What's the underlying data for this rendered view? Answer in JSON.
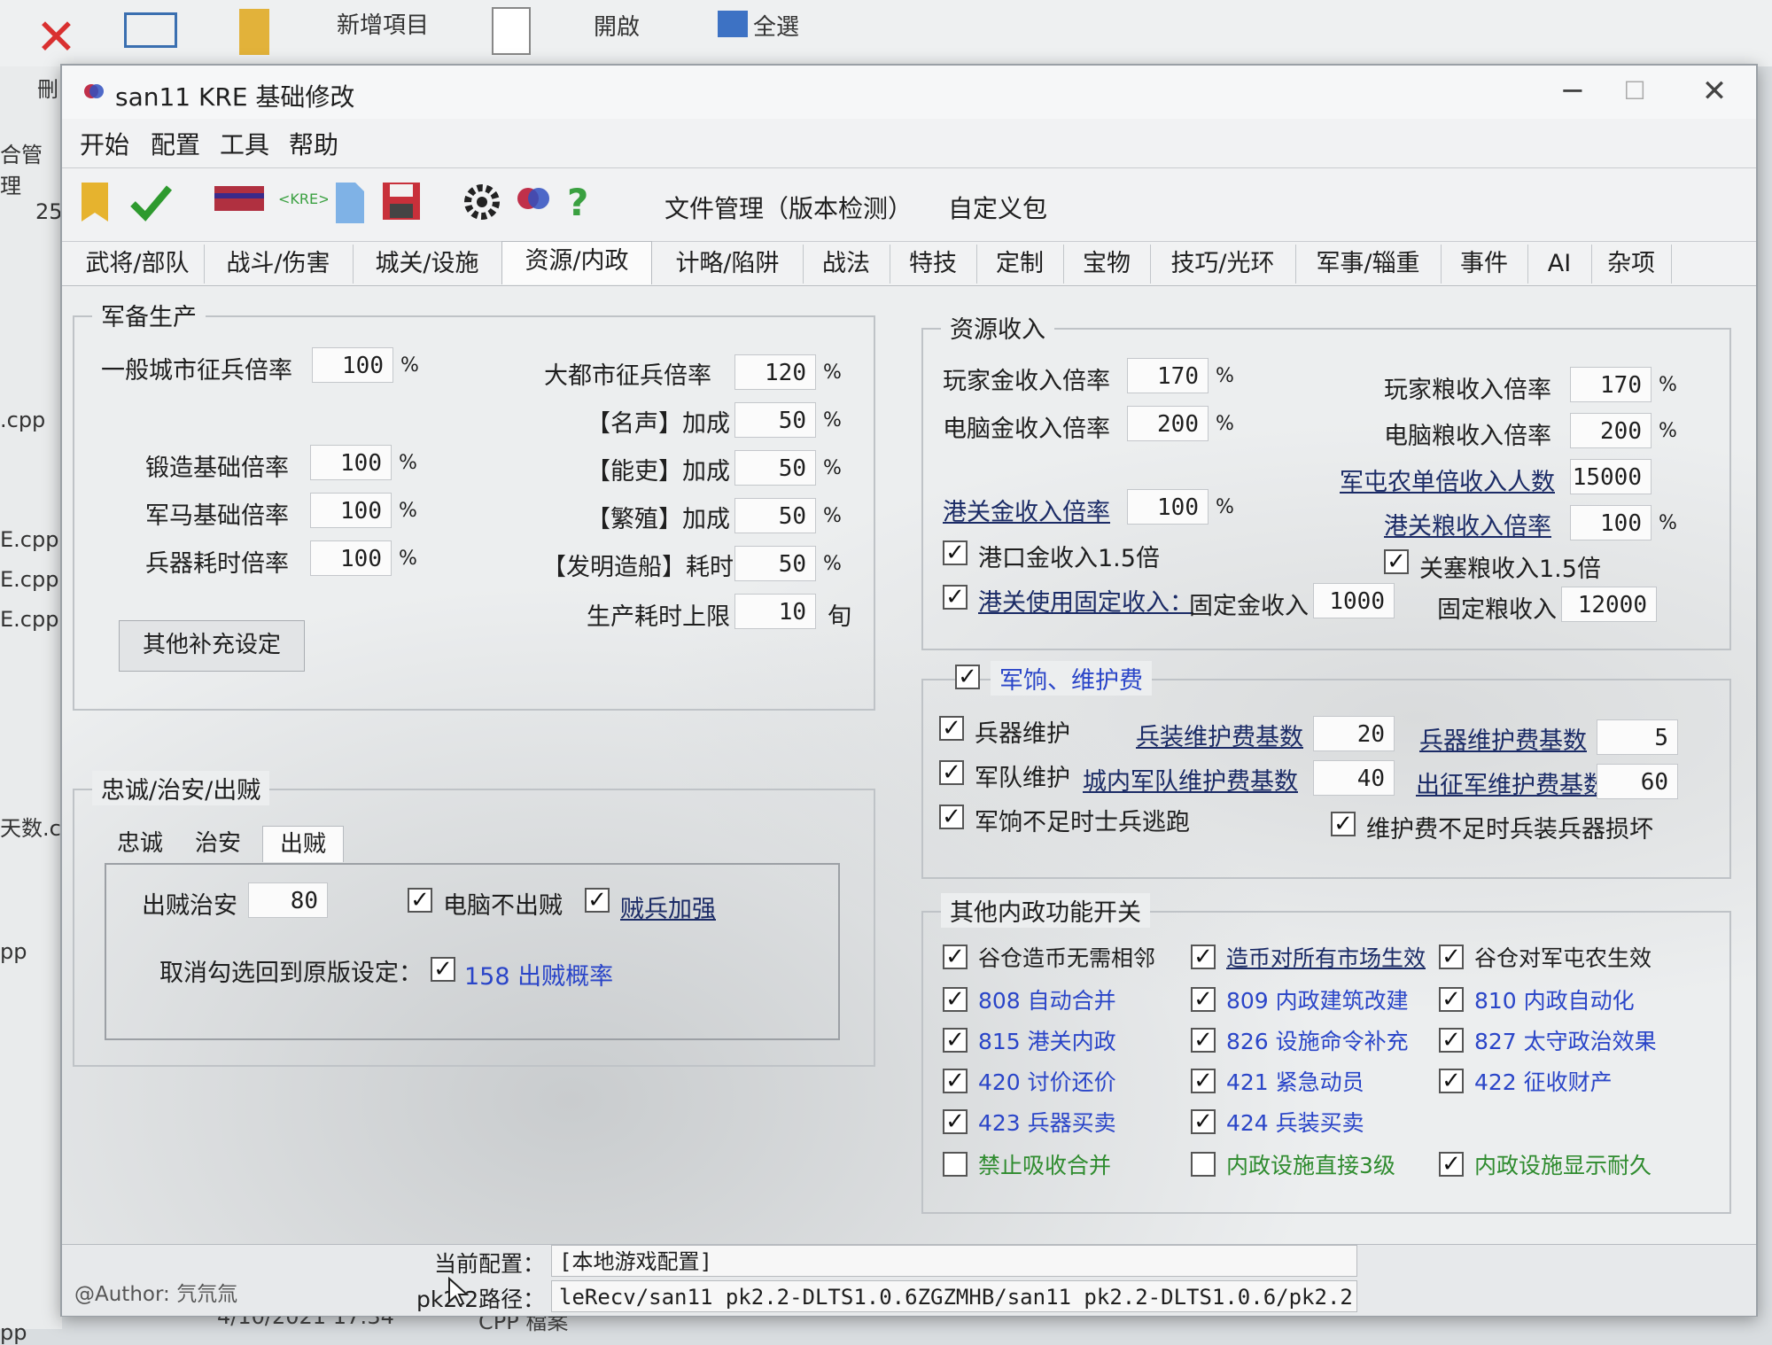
{
  "background": {
    "ribbon_items": [
      "新增項目",
      "開啟",
      "全選"
    ],
    "sidebar_texts": [
      "25",
      ".cpp",
      "E.cpp",
      "E.cpp",
      "E.cpp",
      "天数.c",
      "pp",
      "pp"
    ],
    "sidebar_top": "合管理",
    "left_label": "刪",
    "footer_date": "4/10/2021 17:34",
    "footer_type": "CPP 檔案"
  },
  "window": {
    "title": "san11 KRE 基础修改",
    "controls": {
      "minimize": "─",
      "maximize": "☐",
      "close": "✕"
    }
  },
  "menu": [
    "开始",
    "配置",
    "工具",
    "帮助"
  ],
  "toolbar": {
    "icons": [
      "bookmark-icon",
      "check-icon",
      "kre-logo-icon",
      "kre-arrows-icon",
      "document-icon",
      "save-icon",
      "gear-icon",
      "app-icon",
      "help-icon"
    ],
    "file_mgmt": "文件管理（版本检测）",
    "custom_pack": "自定义包"
  },
  "tabs": [
    "武将/部队",
    "战斗/伤害",
    "城关/设施",
    "资源/内政",
    "计略/陷阱",
    "战法",
    "特技",
    "定制",
    "宝物",
    "技巧/光环",
    "军事/辎重",
    "事件",
    "AI",
    "杂项"
  ],
  "active_tab": "资源/内政",
  "military_production": {
    "title": "军备生产",
    "general_city_rate": {
      "label": "一般城市征兵倍率",
      "value": "100",
      "unit": "%"
    },
    "metro_city_rate": {
      "label": "大都市征兵倍率",
      "value": "120",
      "unit": "%"
    },
    "fame_bonus": {
      "label": "【名声】加成",
      "value": "50",
      "unit": "%"
    },
    "official_bonus": {
      "label": "【能吏】加成",
      "value": "50",
      "unit": "%"
    },
    "breed_bonus": {
      "label": "【繁殖】加成",
      "value": "50",
      "unit": "%"
    },
    "forge_rate": {
      "label": "锻造基础倍率",
      "value": "100",
      "unit": "%"
    },
    "horse_rate": {
      "label": "军马基础倍率",
      "value": "100",
      "unit": "%"
    },
    "weapon_time_rate": {
      "label": "兵器耗时倍率",
      "value": "100",
      "unit": "%"
    },
    "invent_ship_time": {
      "label": "【发明造船】耗时",
      "value": "50",
      "unit": "%"
    },
    "prod_time_cap": {
      "label": "生产耗时上限",
      "value": "10",
      "unit": "旬"
    },
    "other_button": "其他补充设定"
  },
  "loyalty": {
    "title": "忠诚/治安/出贼",
    "subtabs": [
      "忠诚",
      "治安",
      "出贼"
    ],
    "active_subtab": "出贼",
    "bandit_order": {
      "label": "出贼治安",
      "value": "80"
    },
    "pc_no_bandit": {
      "label": "电脑不出贼",
      "checked": true
    },
    "bandit_strong": {
      "label": "贼兵加强",
      "checked": true
    },
    "cancel_label": "取消勾选回到原版设定：",
    "bandit_prob": {
      "label": "158 出贼概率",
      "checked": true
    }
  },
  "resource_income": {
    "title": "资源收入",
    "player_gold": {
      "label": "玩家金收入倍率",
      "value": "170",
      "unit": "%"
    },
    "pc_gold": {
      "label": "电脑金收入倍率",
      "value": "200",
      "unit": "%"
    },
    "player_food": {
      "label": "玩家粮收入倍率",
      "value": "170",
      "unit": "%"
    },
    "pc_food": {
      "label": "电脑粮收入倍率",
      "value": "200",
      "unit": "%"
    },
    "farm_people": {
      "label": "军屯农单倍收入人数",
      "value": "15000"
    },
    "port_gold": {
      "label": "港关金收入倍率",
      "value": "100",
      "unit": "%"
    },
    "port_food": {
      "label": "港关粮收入倍率",
      "value": "100",
      "unit": "%"
    },
    "port_gold_15": {
      "label": "港口金收入1.5倍",
      "checked": true
    },
    "pass_food_15": {
      "label": "关塞粮收入1.5倍",
      "checked": true
    },
    "fixed_income": {
      "label": "港关使用固定收入：",
      "checked": true
    },
    "fixed_gold": {
      "label": "固定金收入",
      "value": "1000"
    },
    "fixed_food": {
      "label": "固定粮收入",
      "value": "12000"
    }
  },
  "upkeep": {
    "title": "军饷、维护费",
    "title_checked": true,
    "weapon_upkeep": {
      "label": "兵器维护",
      "checked": true
    },
    "armor_base": {
      "label": "兵装维护费基数",
      "value": "20"
    },
    "weapon_base": {
      "label": "兵器维护费基数",
      "value": "5"
    },
    "army_upkeep": {
      "label": "军队维护",
      "checked": true
    },
    "city_army_base": {
      "label": "城内军队维护费基数",
      "value": "40"
    },
    "field_army_base": {
      "label": "出征军维护费基数",
      "value": "60"
    },
    "desert": {
      "label": "军饷不足时士兵逃跑",
      "checked": true
    },
    "damage": {
      "label": "维护费不足时兵装兵器损坏",
      "checked": true
    }
  },
  "other_switches": {
    "title": "其他内政功能开关",
    "rows": [
      [
        {
          "label": "谷仓造币无需相邻",
          "checked": true,
          "style": "plain"
        },
        {
          "label": "造币对所有市场生效",
          "checked": true,
          "style": "ulbl"
        },
        {
          "label": "谷仓对军屯农生效",
          "checked": true,
          "style": "plain"
        }
      ],
      [
        {
          "label": "808 自动合并",
          "checked": true,
          "style": "blue"
        },
        {
          "label": "809 内政建筑改建",
          "checked": true,
          "style": "blue"
        },
        {
          "label": "810 内政自动化",
          "checked": true,
          "style": "blue"
        }
      ],
      [
        {
          "label": "815 港关内政",
          "checked": true,
          "style": "blue"
        },
        {
          "label": "826 设施命令补充",
          "checked": true,
          "style": "blue"
        },
        {
          "label": "827 太守政治效果",
          "checked": true,
          "style": "blue"
        }
      ],
      [
        {
          "label": "420 讨价还价",
          "checked": true,
          "style": "blue"
        },
        {
          "label": "421 紧急动员",
          "checked": true,
          "style": "blue"
        },
        {
          "label": "422 征收财产",
          "checked": true,
          "style": "blue"
        }
      ],
      [
        {
          "label": "423 兵器买卖",
          "checked": true,
          "style": "blue"
        },
        {
          "label": "424 兵装买卖",
          "checked": true,
          "style": "blue"
        },
        {
          "label": "",
          "checked": null,
          "style": "plain"
        }
      ],
      [
        {
          "label": "禁止吸收合并",
          "checked": false,
          "style": "green"
        },
        {
          "label": "内政设施直接3级",
          "checked": false,
          "style": "green"
        },
        {
          "label": "内政设施显示耐久",
          "checked": true,
          "style": "green"
        }
      ]
    ]
  },
  "status": {
    "author": "@Author: 氕氘氚",
    "config_label": "当前配置：",
    "config_value": "[本地游戏配置]",
    "path_label": "pk2.2路径：",
    "path_value": "leRecv/san11 pk2.2-DLTS1.0.6ZGZMHB/san11 pk2.2-DLTS1.0.6/pk2.2"
  },
  "colors": {
    "accent_blue": "#2a45c8",
    "accent_green": "#2e8b2e",
    "link": "#1b2b66"
  }
}
